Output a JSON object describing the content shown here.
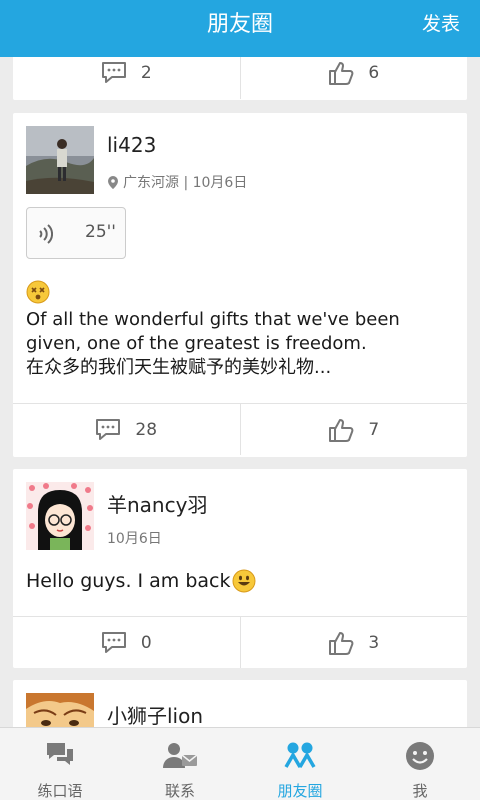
{
  "header": {
    "title": "朋友圈",
    "post_label": "发表"
  },
  "colors": {
    "accent": "#24a6e0",
    "background": "#ececec",
    "card": "#ffffff"
  },
  "posts": [
    {
      "comments": "2",
      "likes": "6"
    },
    {
      "username": "li423",
      "location": "广东河源 | 10月6日",
      "voice_duration": "25''",
      "text_line1": "Of all the wonderful gifts that we've been",
      "text_line2": "given, one of the greatest is freedom.",
      "text_line3": "在众多的我们天生被赋予的美妙礼物...",
      "emoji": "dizzy-face-emoji",
      "comments": "28",
      "likes": "7"
    },
    {
      "username": "羊nancy羽",
      "date": "10月6日",
      "text": "Hello guys. I am back",
      "emoji": "smiley-emoji",
      "comments": "0",
      "likes": "3"
    },
    {
      "username": "小狮子lion"
    }
  ],
  "bottom_nav": [
    {
      "label": "练口语",
      "icon": "chat-bubbles-icon",
      "active": false
    },
    {
      "label": "联系",
      "icon": "contacts-icon",
      "active": false
    },
    {
      "label": "朋友圈",
      "icon": "friends-circle-icon",
      "active": true
    },
    {
      "label": "我",
      "icon": "smiley-profile-icon",
      "active": false
    }
  ]
}
